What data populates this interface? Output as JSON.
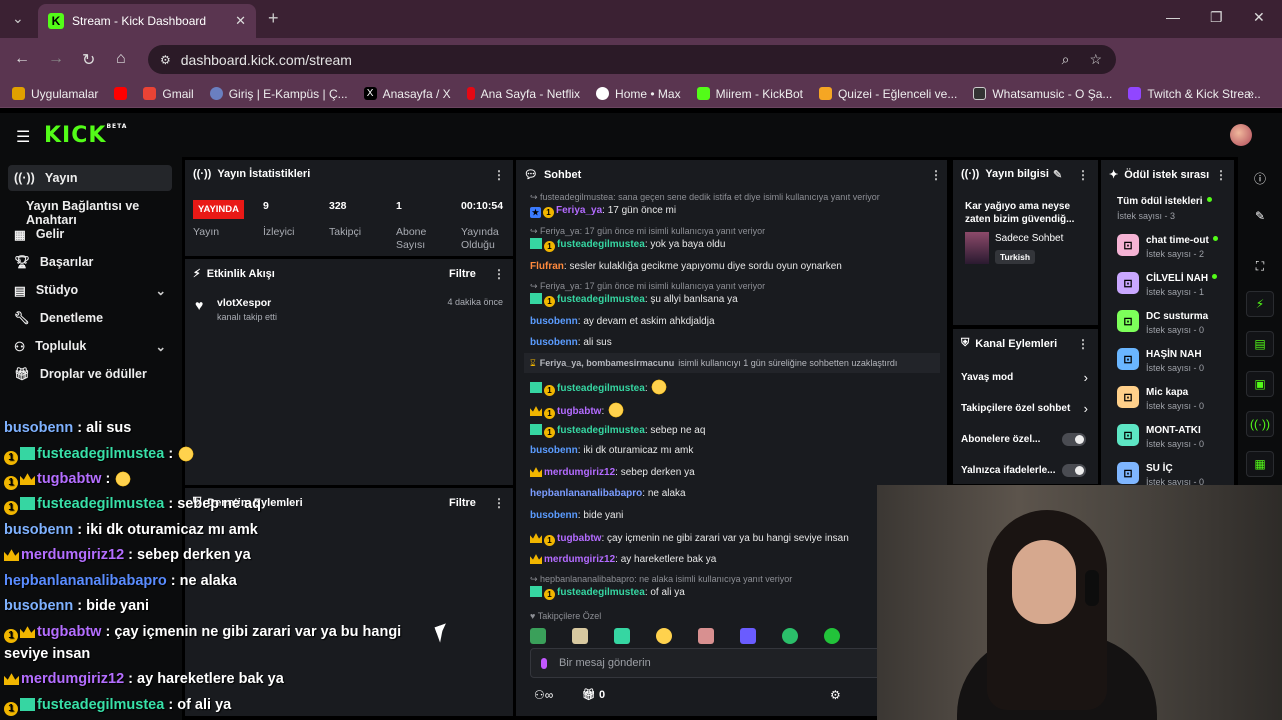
{
  "browser": {
    "tab_title": "Stream - Kick Dashboard",
    "url": "dashboard.kick.com/stream",
    "bookmarks": [
      {
        "label": "Uygulamalar",
        "color": "#e0a000"
      },
      {
        "label": "",
        "color": "#ff0000"
      },
      {
        "label": "Gmail",
        "color": "#ea4335"
      },
      {
        "label": "Giriş | E-Kampüs | Ç...",
        "color": "#6a7fc0"
      },
      {
        "label": "Anasayfa / X",
        "color": "#000000"
      },
      {
        "label": "Ana Sayfa - Netflix",
        "color": "#e50914"
      },
      {
        "label": "Home • Max",
        "color": "#ffffff"
      },
      {
        "label": "Miirem - KickBot",
        "color": "#53fc18"
      },
      {
        "label": "Quizei - Eğlenceli ve...",
        "color": "#f5a623"
      },
      {
        "label": "Whatsamusic - O Şa...",
        "color": "#333333"
      },
      {
        "label": "Twitch & Kick Strea...",
        "color": "#9146ff"
      }
    ]
  },
  "kick": {
    "logo": "KICK",
    "logo_sup": "BETA"
  },
  "sidebar": {
    "items": [
      {
        "label": "Yayın",
        "icon": "broadcast-icon"
      },
      {
        "label": "Yayın Bağlantısı ve Anahtarı"
      },
      {
        "label": "Gelir",
        "icon": "revenue-icon"
      },
      {
        "label": "Başarılar",
        "icon": "trophy-icon"
      },
      {
        "label": "Stüdyo",
        "icon": "studio-icon"
      },
      {
        "label": "Denetleme",
        "icon": "wrench-icon"
      },
      {
        "label": "Topluluk",
        "icon": "community-icon"
      },
      {
        "label": "Droplar ve ödüller",
        "icon": "gift-icon"
      }
    ]
  },
  "stats": {
    "title": "Yayın İstatistikleri",
    "live_badge": "YAYINDA",
    "live_label": "Yayın",
    "viewers": "9",
    "viewers_label": "İzleyici",
    "followers": "328",
    "followers_label": "Takipçi",
    "subs": "1",
    "subs_label": "Abone Sayısı",
    "uptime": "00:10:54",
    "uptime_label": "Yayında Olduğu Süre"
  },
  "activity": {
    "title": "Etkinlik Akışı",
    "filter": "Filtre",
    "event_user": "vlotXespor",
    "event_text": "kanalı takip etti",
    "event_time": "4 dakika önce"
  },
  "modactions": {
    "title": "Denetim Eylemleri",
    "filter": "Filtre"
  },
  "chat": {
    "title": "Sohbet",
    "messages": [
      {
        "reply": "fusteadegilmustea: sana geçen sene dedik istifa et diye isimli kullanıcıya yanıt veriyor",
        "user": "Feriya_ya",
        "text": "17 gün önce mi"
      },
      {
        "reply": "Feriya_ya: 17 gün önce mi isimli kullanıcıya yanıt veriyor",
        "user": "fusteadegilmustea",
        "text": "yok ya baya oldu"
      },
      {
        "user": "Flufran",
        "text": "sesler kulaklığa gecikme yapıyomu diye sordu oyun oynarken"
      },
      {
        "reply": "Feriya_ya: 17 gün önce mi isimli kullanıcıya yanıt veriyor",
        "user": "fusteadegilmustea",
        "text": "şu allyi banlsana ya"
      },
      {
        "user": "busobenn",
        "text": "ay devam et askim ahkdjaldja"
      },
      {
        "user": "busobenn",
        "text": "ali sus"
      },
      {
        "user": "fusteadegilmustea",
        "text": ""
      },
      {
        "user": "tugbabtw",
        "text": ""
      },
      {
        "user": "fusteadegilmustea",
        "text": "sebep ne aq"
      },
      {
        "user": "busobenn",
        "text": "iki dk oturamicaz mı amk"
      },
      {
        "user": "merdumgiriz12",
        "text": "sebep derken ya"
      },
      {
        "user": "hepbanlananalibabapro",
        "text": "ne alaka"
      },
      {
        "user": "busobenn",
        "text": "bide yani"
      },
      {
        "user": "tugbabtw",
        "text": "çay içmenin ne gibi zarari var ya bu hangi seviye insan"
      },
      {
        "user": "merdumgiriz12",
        "text": "ay hareketlere bak ya"
      },
      {
        "reply": "hepbanlananalibabapro: ne alaka isimli kullanıcıya yanıt veriyor",
        "user": "fusteadegilmustea",
        "text": "of ali ya"
      }
    ],
    "ban_notice_users": "Feriya_ya, bombamesirmacunu",
    "ban_notice_text": "isimli kullanıcıyı 1 gün süreliğine sohbetten uzaklaştırdı",
    "followers_only": "Takipçilere Özel",
    "input_placeholder": "Bir mesaj gönderin",
    "bottom_count": "0"
  },
  "streaminfo": {
    "title": "Yayın bilgisi",
    "stream_title": "Kar yağıyo ama neyse zaten bizim güvendiğ...",
    "category": "Sadece Sohbet",
    "language": "Turkish"
  },
  "channelactions": {
    "title": "Kanal Eylemleri",
    "items": [
      "Yavaş mod",
      "Takipçilere özel sohbet",
      "Abonelere özel...",
      "Yalnızca ifadelerle..."
    ]
  },
  "rewards": {
    "title": "Ödül istek sırası",
    "header": "Tüm ödül istekleri",
    "header_count": "İstek sayısı - 3",
    "items": [
      {
        "name": "chat time-out",
        "count": "İstek sayısı - 2",
        "color": "#f5b3d4",
        "active": true
      },
      {
        "name": "CİLVELİ NAH",
        "count": "İstek sayısı - 1",
        "color": "#c9a7ff",
        "active": true
      },
      {
        "name": "DC susturma",
        "count": "İstek sayısı - 0",
        "color": "#7dff5a",
        "active": false
      },
      {
        "name": "HAŞİN NAH",
        "count": "İstek sayısı - 0",
        "color": "#6ab6ff",
        "active": false
      },
      {
        "name": "Mic kapa",
        "count": "İstek sayısı - 0",
        "color": "#ffd08a",
        "active": false
      },
      {
        "name": "MONT-ATKI",
        "count": "İstek sayısı - 0",
        "color": "#5de6c4",
        "active": false
      },
      {
        "name": "SU İÇ",
        "count": "İstek sayısı - 0",
        "color": "#7fb6ff",
        "active": false
      }
    ]
  },
  "overlay": {
    "lines": [
      {
        "user": "busobenn",
        "text": "ali sus"
      },
      {
        "user": "fusteadegilmustea",
        "text": ""
      },
      {
        "user": "tugbabtw",
        "text": ""
      },
      {
        "user": "fusteadegilmustea",
        "text": "sebep ne aq"
      },
      {
        "user": "busobenn",
        "text": "iki dk oturamicaz mı amk"
      },
      {
        "user": "merdumgiriz12",
        "text": "sebep derken ya"
      },
      {
        "user": "hepbanlananalibabapro",
        "text": "ne alaka"
      },
      {
        "user": "busobenn",
        "text": "bide yani"
      },
      {
        "user": "tugbabtw",
        "text": "çay içmenin ne gibi zarari var ya bu hangi"
      },
      {
        "user": "",
        "text": "seviye insan"
      },
      {
        "user": "merdumgiriz12",
        "text": "ay hareketlere bak ya"
      },
      {
        "user": "fusteadegilmustea",
        "text": "of ali ya"
      }
    ]
  }
}
